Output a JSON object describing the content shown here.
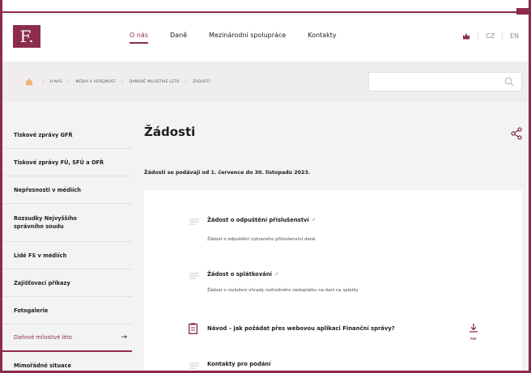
{
  "corner": "4",
  "header": {
    "logo": "F.",
    "nav": [
      "O nás",
      "Daně",
      "Mezinárodní spolupráce",
      "Kontakty"
    ],
    "lang": [
      "CZ",
      "EN"
    ]
  },
  "breadcrumb": [
    "O NÁS",
    "MÉDIA A VEŘEJNOST",
    "DAŇOVÉ MILOSTIVÉ LÉTO",
    "ŽÁDOSTI"
  ],
  "sidebar": [
    "Tiskové zprávy GFŘ",
    "Tiskové zprávy FÚ, SFÚ a OFŘ",
    "Nepřesnosti v médiích",
    "Rozsudky Nejvyššího správního soudu",
    "Lidé FS v médiích",
    "Zajišťovací příkazy",
    "Fotogalerie",
    "Daňové milostivé léto",
    "Mimořádné situace"
  ],
  "sidebar_arrow": "→",
  "main": {
    "title": "Žádosti",
    "intro": "Žádosti se podávají od 1. července do 30. listopadu 2023.",
    "items": [
      {
        "title": "Žádost o odpuštění příslušenství",
        "ext": "↗",
        "desc": "Žádost o odpuštění vybraného příslušenství daně"
      },
      {
        "title": "Žádost o splátkování",
        "ext": "↗",
        "desc": "Žádost o rozložení úhrady rozhodného nedoplatku na dani na splátky"
      },
      {
        "title": "Návod – jak požádat přes webovou aplikaci Finanční správy?",
        "badge": "PDF"
      },
      {
        "title": "Kontakty pro podání"
      }
    ]
  },
  "colors": {
    "brand": "#8b2c4d",
    "bar": "#efedee",
    "page": "#f4f3f3"
  },
  "icons": [
    "home-icon",
    "search-icon",
    "share-icon",
    "document-icon",
    "clipboard-icon",
    "pdf-download-icon",
    "crown-icon",
    "external-link-icon"
  ]
}
